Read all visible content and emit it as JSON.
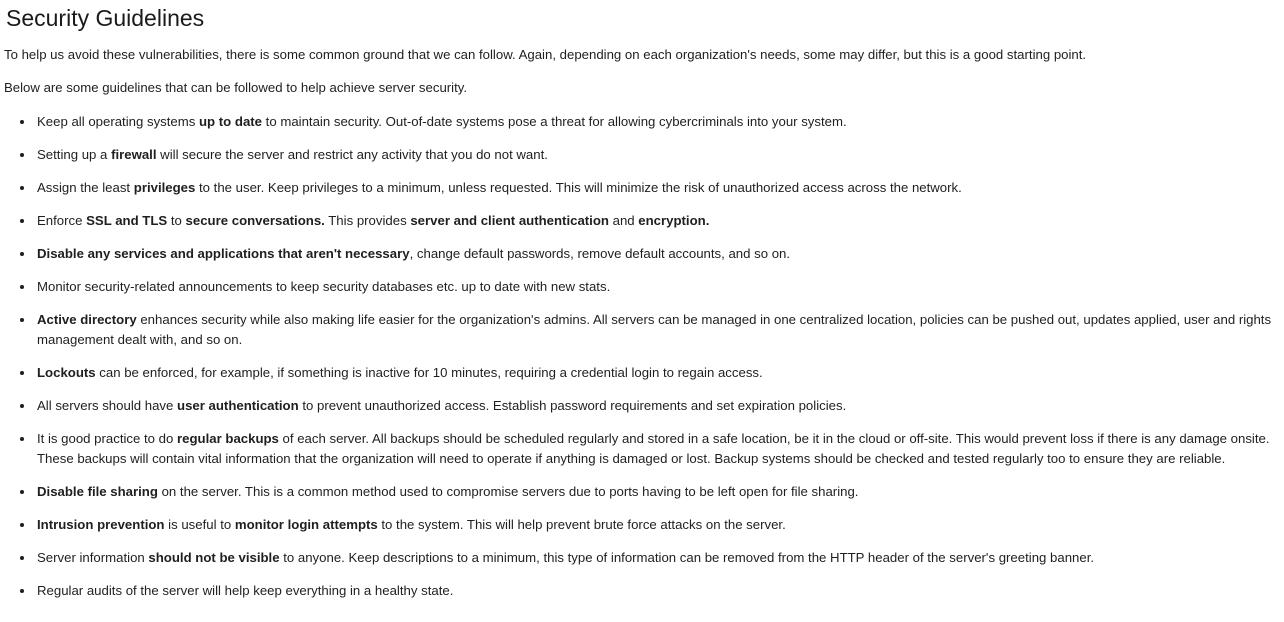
{
  "title": "Security Guidelines",
  "intro": [
    "To help us avoid these vulnerabilities, there is some common ground that we can follow. Again, depending on each organization's needs, some may differ, but this is a good starting point.",
    "Below are some guidelines that can be followed to help achieve server security."
  ],
  "guidelines": [
    [
      {
        "t": "Keep all operating systems "
      },
      {
        "t": "up to date",
        "b": true
      },
      {
        "t": " to maintain security. Out-of-date systems pose a threat for allowing cybercriminals into your system."
      }
    ],
    [
      {
        "t": "Setting up a "
      },
      {
        "t": "firewall",
        "b": true
      },
      {
        "t": " will secure the server and restrict any activity that you do not want."
      }
    ],
    [
      {
        "t": "Assign the least "
      },
      {
        "t": "privileges",
        "b": true
      },
      {
        "t": " to the user. Keep privileges to a minimum, unless requested. This will minimize the risk of unauthorized access across the network."
      }
    ],
    [
      {
        "t": "Enforce "
      },
      {
        "t": "SSL and TLS",
        "b": true
      },
      {
        "t": " to "
      },
      {
        "t": "secure conversations.",
        "b": true
      },
      {
        "t": " This provides "
      },
      {
        "t": "server and client authentication",
        "b": true
      },
      {
        "t": " and "
      },
      {
        "t": "encryption.",
        "b": true
      }
    ],
    [
      {
        "t": "Disable any services and applications that aren't necessary",
        "b": true
      },
      {
        "t": ", change default passwords, remove default accounts, and so on."
      }
    ],
    [
      {
        "t": "Monitor security-related announcements to keep security databases etc. up to date with new stats."
      }
    ],
    [
      {
        "t": "Active directory",
        "b": true
      },
      {
        "t": " enhances security while also making life easier for the organization's admins. All servers can be managed in one centralized location, policies can be pushed out, updates applied, user and rights management dealt with, and so on."
      }
    ],
    [
      {
        "t": "Lockouts",
        "b": true
      },
      {
        "t": " can be enforced, for example, if something is inactive for 10 minutes, requiring a credential login to regain access."
      }
    ],
    [
      {
        "t": "All servers should have "
      },
      {
        "t": "user authentication",
        "b": true
      },
      {
        "t": " to prevent unauthorized access. Establish password requirements and set expiration policies."
      }
    ],
    [
      {
        "t": "It is good practice to do "
      },
      {
        "t": "regular backups",
        "b": true
      },
      {
        "t": " of each server. All backups should be scheduled regularly and stored in a safe location, be it in the cloud or off-site. This would prevent loss if there is any damage onsite. These backups will contain vital information that the organization will need to operate if anything is damaged or lost. Backup systems should be checked and tested regularly too to ensure they are reliable."
      }
    ],
    [
      {
        "t": "Disable file sharing",
        "b": true
      },
      {
        "t": " on the server. This is a common method used to compromise servers due to ports having to be left open for file sharing."
      }
    ],
    [
      {
        "t": "Intrusion prevention",
        "b": true
      },
      {
        "t": " is useful to "
      },
      {
        "t": "monitor login attempts",
        "b": true
      },
      {
        "t": " to the system. This will help prevent brute force attacks on the server."
      }
    ],
    [
      {
        "t": "Server information "
      },
      {
        "t": "should not be visible",
        "b": true
      },
      {
        "t": " to anyone. Keep descriptions to a minimum, this type of information can be removed from the HTTP header of the server's greeting banner."
      }
    ],
    [
      {
        "t": "Regular audits of the server will help keep everything in a healthy state."
      }
    ]
  ]
}
